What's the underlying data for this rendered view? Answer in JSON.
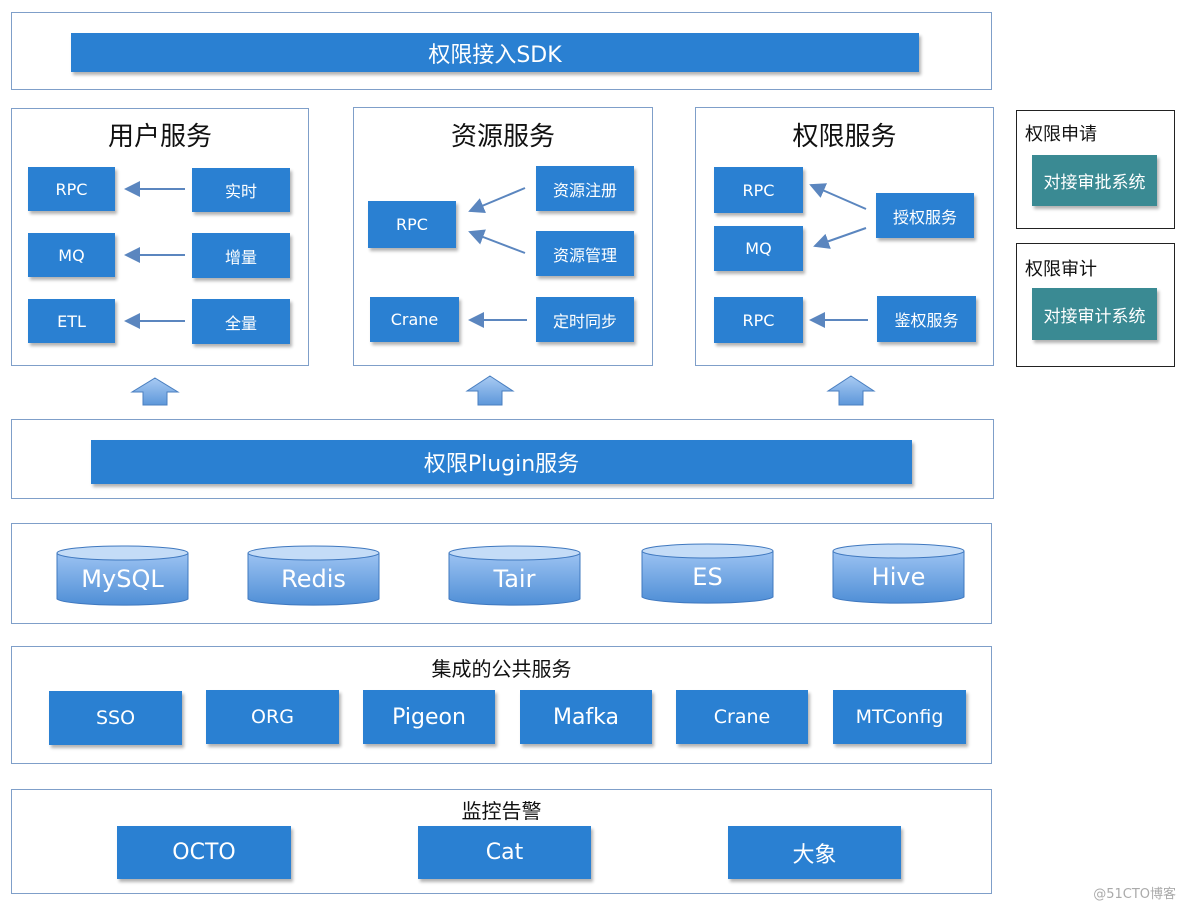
{
  "sdk": {
    "label": "权限接入SDK"
  },
  "user_service": {
    "title": "用户服务",
    "left": [
      "RPC",
      "MQ",
      "ETL"
    ],
    "right": [
      "实时",
      "增量",
      "全量"
    ]
  },
  "resource_service": {
    "title": "资源服务",
    "rpc": "RPC",
    "crane": "Crane",
    "register": "资源注册",
    "manage": "资源管理",
    "sync": "定时同步"
  },
  "perm_service": {
    "title": "权限服务",
    "rpc1": "RPC",
    "mq": "MQ",
    "rpc2": "RPC",
    "grant": "授权服务",
    "auth": "鉴权服务"
  },
  "side": {
    "apply_title": "权限申请",
    "apply_box": "对接审批系统",
    "audit_title": "权限审计",
    "audit_box": "对接审计系统"
  },
  "plugin": {
    "label": "权限Plugin服务"
  },
  "storage": [
    "MySQL",
    "Redis",
    "Tair",
    "ES",
    "Hive"
  ],
  "common": {
    "title": "集成的公共服务",
    "items": [
      "SSO",
      "ORG",
      "Pigeon",
      "Mafka",
      "Crane",
      "MTConfig"
    ]
  },
  "monitor": {
    "title": "监控告警",
    "items": [
      "OCTO",
      "Cat",
      "大象"
    ]
  },
  "watermark": "@51CTO博客",
  "colors": {
    "box": "#2a80d2",
    "teal": "#3a8a93",
    "frame": "#7f9fc9"
  }
}
